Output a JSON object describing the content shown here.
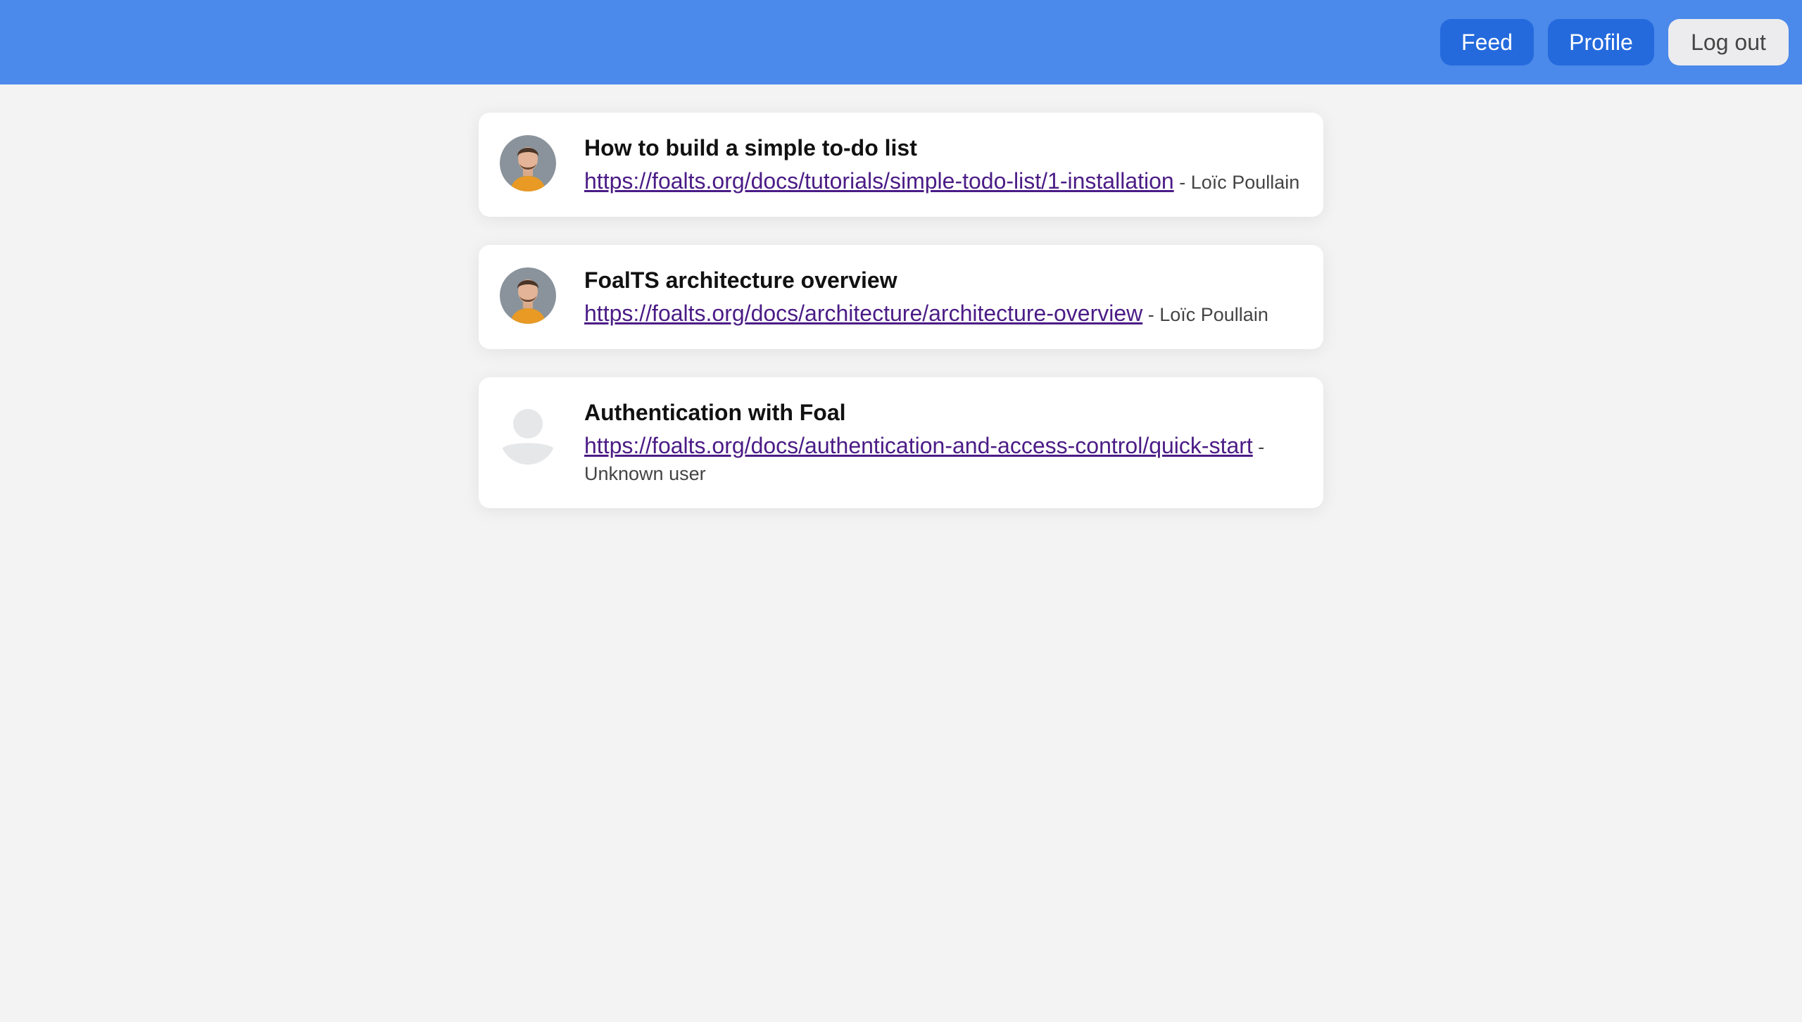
{
  "nav": {
    "feed_label": "Feed",
    "profile_label": "Profile",
    "logout_label": "Log out"
  },
  "colors": {
    "header": "#4b89ea",
    "primary_button": "#246add",
    "light_button": "#ececee",
    "link": "#4b1c86",
    "background": "#f3f3f3"
  },
  "stories": [
    {
      "title": "How to build a simple to-do list",
      "link": "https://foalts.org/docs/tutorials/simple-todo-list/1-installation",
      "separator": " - ",
      "author": "Loïc Poullain",
      "avatar": "user-photo"
    },
    {
      "title": "FoalTS architecture overview",
      "link": "https://foalts.org/docs/architecture/architecture-overview",
      "separator": " - ",
      "author": "Loïc Poullain",
      "avatar": "user-photo"
    },
    {
      "title": "Authentication with Foal",
      "link": "https://foalts.org/docs/authentication-and-access-control/quick-start",
      "separator": " - ",
      "author": "Unknown user",
      "avatar": "default-user-icon"
    }
  ]
}
